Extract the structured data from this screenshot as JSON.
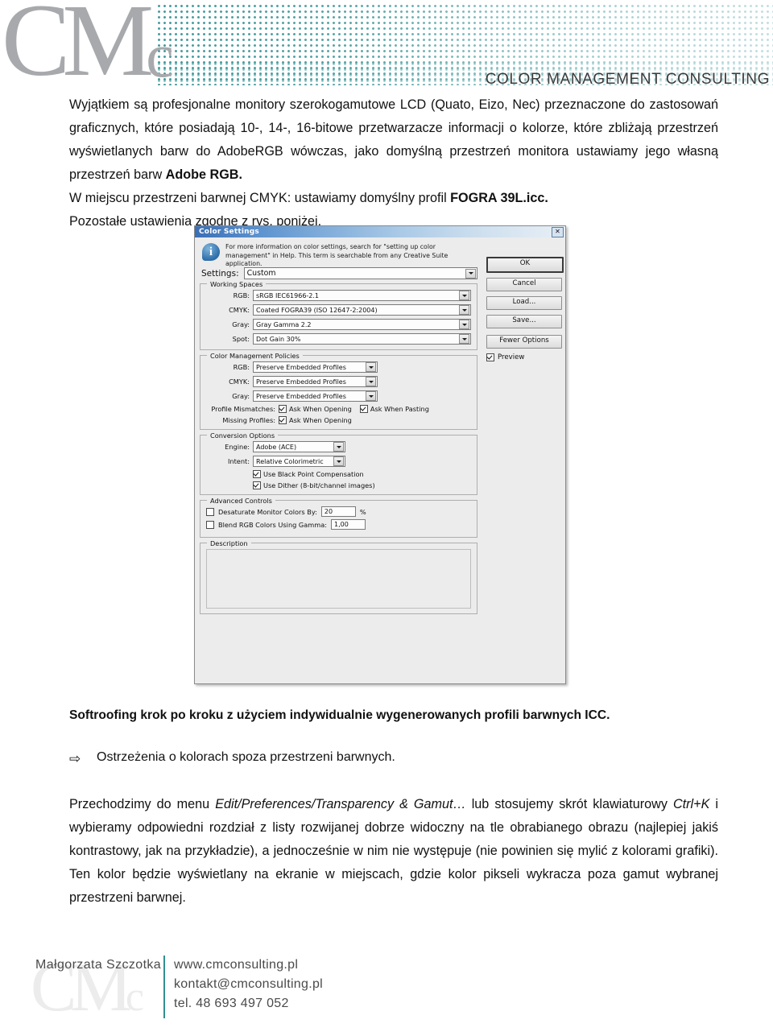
{
  "header": {
    "logo_text": "CMc",
    "tagline": "COLOR MANAGEMENT CONSULTING"
  },
  "body": {
    "paragraph1_part1": "Wyjątkiem są profesjonalne monitory szerokogamutowe LCD (Quato, Eizo, Nec) przeznaczone do zastosowań graficznych, które posiadają 10-, 14-, 16-bitowe przetwarzacze informacji o kolorze, które zbliżają przestrzeń wyświetlanych barw do AdobeRGB wówczas, jako domyślną przestrzeń monitora ustawiamy jego własną przestrzeń barw ",
    "paragraph1_bold1": "Adobe RGB.",
    "paragraph2_part1": "W miejscu przestrzeni barwnej CMYK: ustawiamy domyślny profil ",
    "paragraph2_bold1": "FOGRA 39L.icc.",
    "paragraph3": "Pozostałe ustawienia zgodne z rys. poniżej.",
    "subheading": "Softroofing krok po kroku z użyciem indywidualnie wygenerowanych profili barwnych ICC.",
    "bullet_arrow": "⇨",
    "bullet_text": "Ostrzeżenia o kolorach spoza przestrzeni barwnych.",
    "paragraph4_part1": "Przechodzimy do menu ",
    "paragraph4_italic1": "Edit/Preferences/Transparency & Gamut…",
    "paragraph4_part2": " lub stosujemy skrót klawiaturowy ",
    "paragraph4_italic2": "Ctrl+K",
    "paragraph4_part3": " i wybieramy odpowiedni rozdział z listy rozwijanej dobrze widoczny na tle obrabianego obrazu (najlepiej jakiś kontrastowy, jak na przykładzie), a jednocześnie w nim nie występuje (nie powinien się mylić z kolorami grafiki). Ten kolor będzie wyświetlany na ekranie w miejscach, gdzie kolor pikseli wykracza poza gamut wybranej przestrzeni barwnej."
  },
  "dialog": {
    "title": "Color Settings",
    "close_label": "✕",
    "info_text": "For more information on color settings, search for \"setting up color management\" in Help. This term is searchable from any Creative Suite application.",
    "settings_label": "Settings:",
    "settings_value": "Custom",
    "buttons": {
      "ok": "OK",
      "cancel": "Cancel",
      "load": "Load...",
      "save": "Save...",
      "fewer_options": "Fewer Options"
    },
    "preview": {
      "label": "Preview",
      "checked": true
    },
    "working_spaces": {
      "legend": "Working Spaces",
      "rows": [
        {
          "label": "RGB:",
          "value": "sRGB IEC61966-2.1"
        },
        {
          "label": "CMYK:",
          "value": "Coated FOGRA39 (ISO 12647-2:2004)"
        },
        {
          "label": "Gray:",
          "value": "Gray Gamma 2.2"
        },
        {
          "label": "Spot:",
          "value": "Dot Gain 30%"
        }
      ]
    },
    "policies": {
      "legend": "Color Management Policies",
      "rows": [
        {
          "label": "RGB:",
          "value": "Preserve Embedded Profiles"
        },
        {
          "label": "CMYK:",
          "value": "Preserve Embedded Profiles"
        },
        {
          "label": "Gray:",
          "value": "Preserve Embedded Profiles"
        }
      ],
      "profile_mismatches_label": "Profile Mismatches:",
      "mismatch_open_label": "Ask When Opening",
      "mismatch_paste_label": "Ask When Pasting",
      "missing_profiles_label": "Missing Profiles:",
      "missing_open_label": "Ask When Opening"
    },
    "conversion": {
      "legend": "Conversion Options",
      "engine_label": "Engine:",
      "engine_value": "Adobe (ACE)",
      "intent_label": "Intent:",
      "intent_value": "Relative Colorimetric",
      "bpc_label": "Use Black Point Compensation",
      "dither_label": "Use Dither (8-bit/channel images)"
    },
    "advanced": {
      "legend": "Advanced Controls",
      "desaturate_label": "Desaturate Monitor Colors By:",
      "desaturate_value": "20",
      "desaturate_unit": "%",
      "blend_label": "Blend RGB Colors Using Gamma:",
      "blend_value": "1,00"
    },
    "description": {
      "legend": "Description",
      "value": ""
    }
  },
  "footer": {
    "watermark": "CMc",
    "name": "Małgorzata Szczotka",
    "website": "www.cmconsulting.pl",
    "email": "kontakt@cmconsulting.pl",
    "phone": "tel. 48 693 497 052"
  },
  "colors": {
    "accent_teal": "#2f8f8f",
    "logo_gray": "#a7a9ac",
    "title_blue": "#3a6fb5"
  }
}
